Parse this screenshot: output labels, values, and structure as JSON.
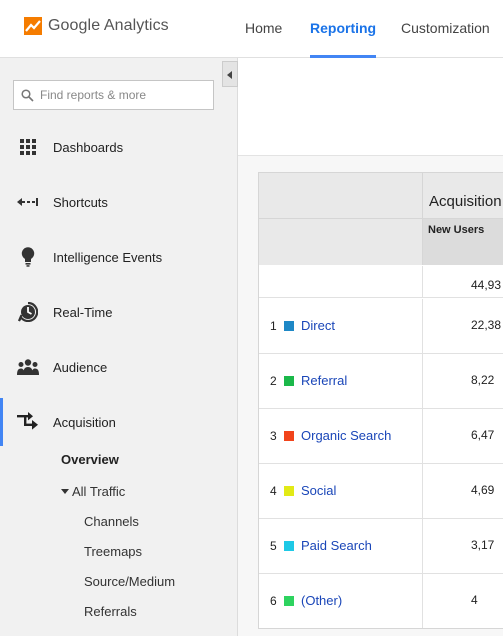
{
  "header": {
    "logo_text": "Google Analytics",
    "nav": [
      {
        "label": "Home"
      },
      {
        "label": "Reporting"
      },
      {
        "label": "Customization"
      }
    ],
    "active_nav": "Reporting"
  },
  "sidebar": {
    "search_placeholder": "Find reports & more",
    "items": [
      {
        "label": "Dashboards",
        "icon": "grid-icon"
      },
      {
        "label": "Shortcuts",
        "icon": "shortcut-arrow-icon"
      },
      {
        "label": "Intelligence Events",
        "icon": "lightbulb-icon"
      },
      {
        "label": "Real-Time",
        "icon": "clock-icon"
      },
      {
        "label": "Audience",
        "icon": "people-icon"
      },
      {
        "label": "Acquisition",
        "icon": "acquisition-arrows-icon"
      }
    ],
    "acquisition_sub": {
      "overview": "Overview",
      "all_traffic": "All Traffic",
      "children": [
        "Channels",
        "Treemaps",
        "Source/Medium",
        "Referrals"
      ]
    }
  },
  "table": {
    "section_title": "Acquisition",
    "metric_header": "New Users",
    "total": "44,93",
    "rows": [
      {
        "rank": "1",
        "channel": "Direct",
        "color": "#1e88c6",
        "new_users": "22,38"
      },
      {
        "rank": "2",
        "channel": "Referral",
        "color": "#1bb84a",
        "new_users": "8,22"
      },
      {
        "rank": "3",
        "channel": "Organic Search",
        "color": "#f1441b",
        "new_users": "6,47"
      },
      {
        "rank": "4",
        "channel": "Social",
        "color": "#e2ea16",
        "new_users": "4,69"
      },
      {
        "rank": "5",
        "channel": "Paid Search",
        "color": "#1ec9e6",
        "new_users": "3,17"
      },
      {
        "rank": "6",
        "channel": "(Other)",
        "color": "#2ed35f",
        "new_users": "4"
      }
    ]
  },
  "colors": {
    "accent": "#4285f4",
    "link": "#1a46b8",
    "sidebar_bg": "#f1f1f1"
  }
}
